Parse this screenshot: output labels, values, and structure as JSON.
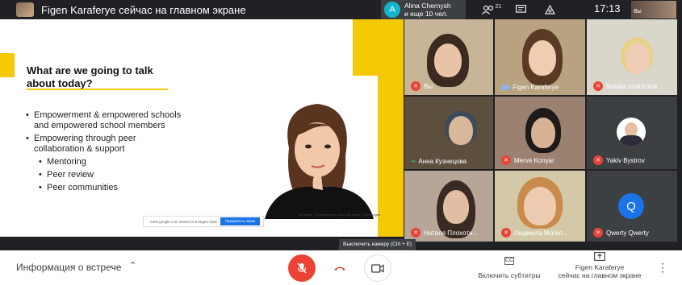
{
  "topbar": {
    "presenting_title": "Figen Karaferye сейчас на главном экране",
    "chip_initial": "A",
    "chip_line1": "Alina Chernysh",
    "chip_line2": "и еще 10 чел.",
    "participants_count": "21",
    "clock": "17:13",
    "self_label": "Вы"
  },
  "slide": {
    "heading": "What are we going to talk about today?",
    "bullets": [
      "Empowerment & empowered schools and empowered school members",
      "Empowering through peer collaboration & support",
      "Mentoring",
      "Peer review",
      "Peer communities"
    ],
    "caption": "по medkit, обучению техн. коуч-таб Фото: Getty/Images",
    "gbar_text": "meet.google.com является в видео-прис",
    "gbar_button": "Прекратить показ"
  },
  "participants": [
    "Вы",
    "Figen Karaferye",
    "Natalia Andriichuk",
    "Анна Кузнецова",
    "Merve Konyar",
    "Yakiv Bystrov",
    "Наталя Плохотн...",
    "Людмила Могел...",
    "Qwerty Qwerty"
  ],
  "qwerty_initial": "Q",
  "tooltip": "Выключить камеру (Ctrl + E)",
  "bottom": {
    "meeting_info": "Информация о встрече",
    "subtitles": "Включить субтитры",
    "cc_icon": "CC",
    "presenter_line1": "Figen Karaferye",
    "presenter_line2": "сейчас на главном экране"
  },
  "colors": {
    "accent_yellow": "#f6c907",
    "mic_off_red": "#ea4335",
    "speaking_blue": "#8ab4f8",
    "avatar_blue": "#1a73e8"
  }
}
